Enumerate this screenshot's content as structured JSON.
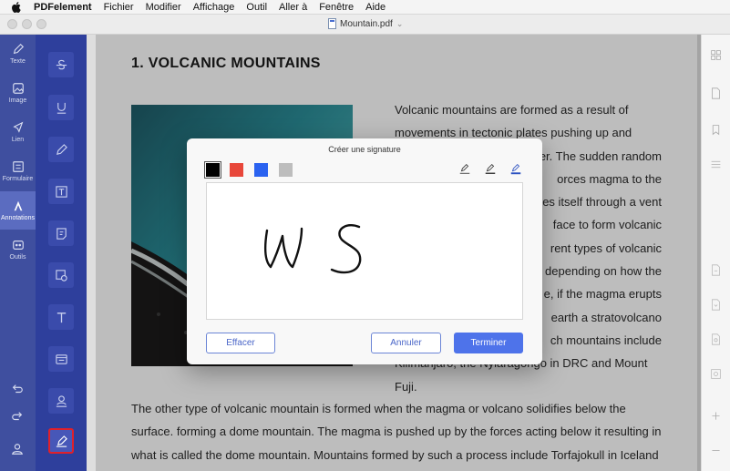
{
  "menubar": {
    "app_name": "PDFelement",
    "items": [
      "Fichier",
      "Modifier",
      "Affichage",
      "Outil",
      "Aller à",
      "Fenêtre",
      "Aide"
    ]
  },
  "window": {
    "title": "Mountain.pdf"
  },
  "left_nav": {
    "items": [
      {
        "label": "Texte",
        "icon": "pencil-icon"
      },
      {
        "label": "Image",
        "icon": "image-icon"
      },
      {
        "label": "Lien",
        "icon": "link-icon"
      },
      {
        "label": "Formulaire",
        "icon": "form-icon"
      },
      {
        "label": "Annotations",
        "icon": "annotation-icon",
        "active": true
      },
      {
        "label": "Outils",
        "icon": "tools-icon"
      }
    ]
  },
  "document": {
    "heading": "1. VOLCANIC MOUNTAINS",
    "paragraph_right": "Volcanic mountains are formed as a result of movements in tectonic plates pushing up and er. The sudden random orces magma to the ces itself through a vent face to form volcanic rent types of volcanic depending on how the e, if the magma erupts earth a stratovolcano ch mountains include",
    "lines_right": [
      "Volcanic mountains are formed as a result of",
      "movements in tectonic plates pushing up and",
      "er. The sudden random",
      "orces magma to the",
      "ces itself through a vent",
      "face to form volcanic",
      "rent types of volcanic",
      "depending on how the",
      "e, if the magma erupts",
      "earth a stratovolcano",
      "ch mountains include",
      "Kilimanjaro, the Nyiaragongo in DRC and Mount",
      "Fuji."
    ],
    "lines_full": [
      "The other type of volcanic mountain is formed when the magma or volcano solidifies below the",
      "surface. forming a dome mountain. The magma is pushed up by the forces acting below it resulting in",
      "what is called the dome mountain. Mountains formed by such a process include Torfajokull in Iceland"
    ]
  },
  "dialog": {
    "title": "Créer une signature",
    "colors": [
      "#000000",
      "#e8473a",
      "#2a62f0",
      "#bdbdbd"
    ],
    "selected_color": "#000000",
    "signature_text": "W S",
    "buttons": {
      "clear": "Effacer",
      "cancel": "Annuler",
      "finish": "Terminer"
    }
  }
}
